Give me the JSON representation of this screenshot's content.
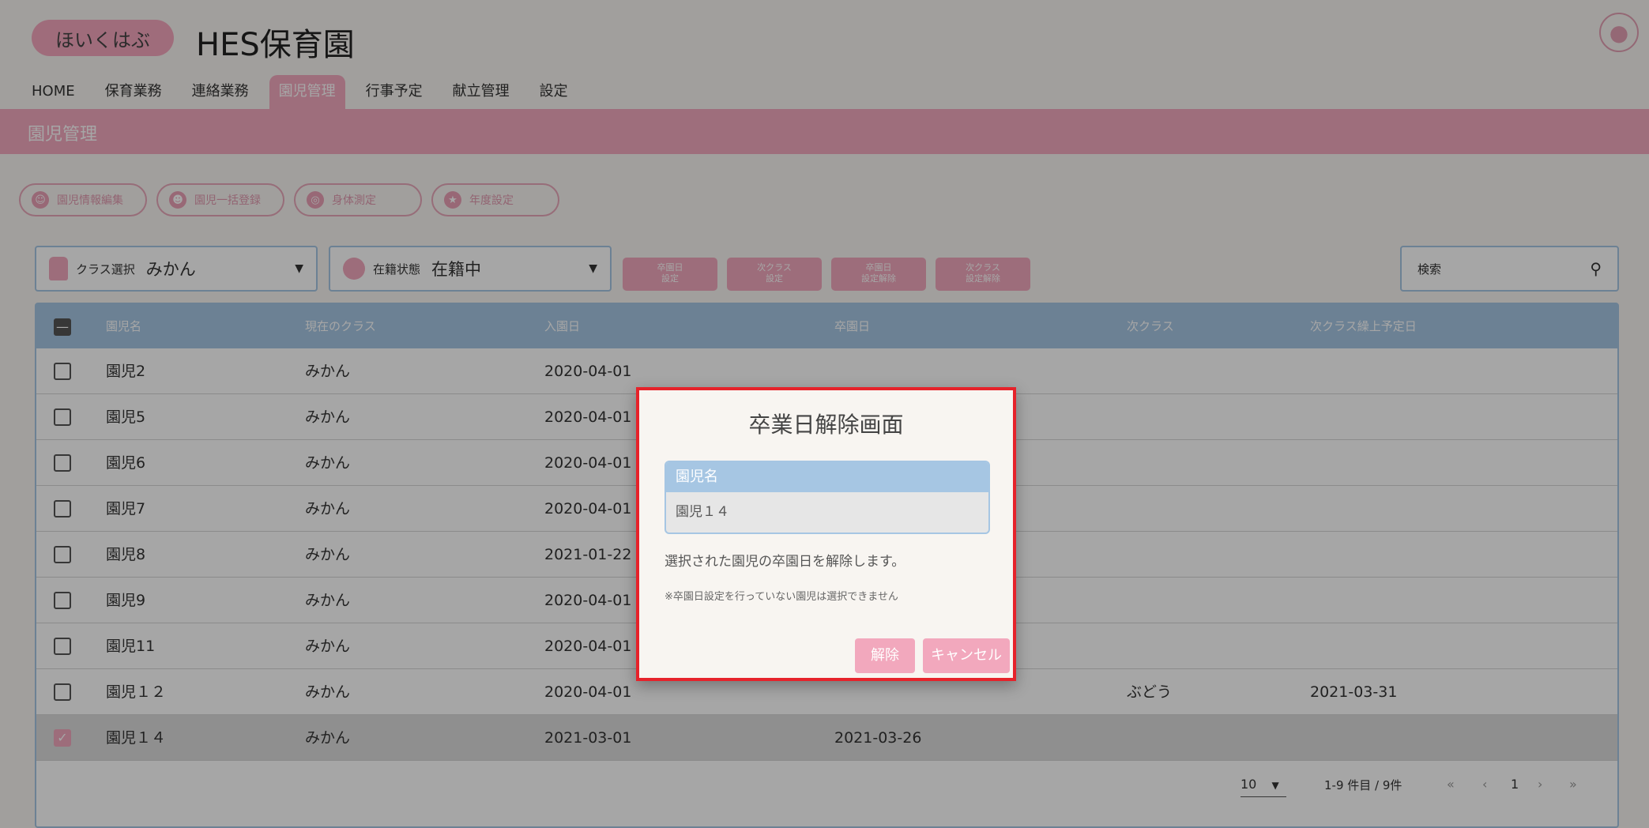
{
  "header": {
    "logo_text": "ほいくはぶ",
    "brand_title": "HES保育園",
    "nav": [
      "HOME",
      "保育業務",
      "連絡業務",
      "園児管理",
      "行事予定",
      "献立管理",
      "設定"
    ],
    "active_nav": "園児管理"
  },
  "page_title": "園児管理",
  "action_pills": [
    "園児情報編集",
    "園児一括登録",
    "身体測定",
    "年度設定"
  ],
  "filters": {
    "class_label": "クラス選択",
    "class_value": "みかん",
    "status_label": "在籍状態",
    "status_value": "在籍中"
  },
  "action_buttons": [
    {
      "line1": "卒園日",
      "line2": "設定"
    },
    {
      "line1": "次クラス",
      "line2": "設定"
    },
    {
      "line1": "卒園日",
      "line2": "設定解除"
    },
    {
      "line1": "次クラス",
      "line2": "設定解除"
    }
  ],
  "search": {
    "placeholder": "検索"
  },
  "table": {
    "columns": [
      "園児名",
      "現在のクラス",
      "入園日",
      "卒園日",
      "次クラス",
      "次クラス繰上予定日"
    ],
    "rows": [
      {
        "name": "園児2",
        "class": "みかん",
        "entry": "2020-04-01",
        "grad": "",
        "next": "",
        "next_date": "",
        "checked": false
      },
      {
        "name": "園児5",
        "class": "みかん",
        "entry": "2020-04-01",
        "grad": "",
        "next": "",
        "next_date": "",
        "checked": false
      },
      {
        "name": "園児6",
        "class": "みかん",
        "entry": "2020-04-01",
        "grad": "",
        "next": "",
        "next_date": "",
        "checked": false
      },
      {
        "name": "園児7",
        "class": "みかん",
        "entry": "2020-04-01",
        "grad": "",
        "next": "",
        "next_date": "",
        "checked": false
      },
      {
        "name": "園児8",
        "class": "みかん",
        "entry": "2021-01-22",
        "grad": "",
        "next": "",
        "next_date": "",
        "checked": false
      },
      {
        "name": "園児9",
        "class": "みかん",
        "entry": "2020-04-01",
        "grad": "",
        "next": "",
        "next_date": "",
        "checked": false
      },
      {
        "name": "園児11",
        "class": "みかん",
        "entry": "2020-04-01",
        "grad": "",
        "next": "",
        "next_date": "",
        "checked": false
      },
      {
        "name": "園児１２",
        "class": "みかん",
        "entry": "2020-04-01",
        "grad": "",
        "next": "ぶどう",
        "next_date": "2021-03-31",
        "checked": false
      },
      {
        "name": "園児１４",
        "class": "みかん",
        "entry": "2021-03-01",
        "grad": "2021-03-26",
        "next": "",
        "next_date": "",
        "checked": true
      }
    ]
  },
  "pagination": {
    "per_page": "10",
    "range": "1-9 件目 / 9件",
    "page": "1"
  },
  "modal": {
    "title": "卒業日解除画面",
    "table_header": "園児名",
    "table_value": "園児１４",
    "message": "選択された園児の卒園日を解除します。",
    "note": "※卒園日設定を行っていない園児は選択できません",
    "confirm_label": "解除",
    "cancel_label": "キャンセル"
  },
  "colors": {
    "accent_pink": "#f3a9bf",
    "accent_blue": "#a6c6e3",
    "highlight_border": "#e6222a"
  }
}
